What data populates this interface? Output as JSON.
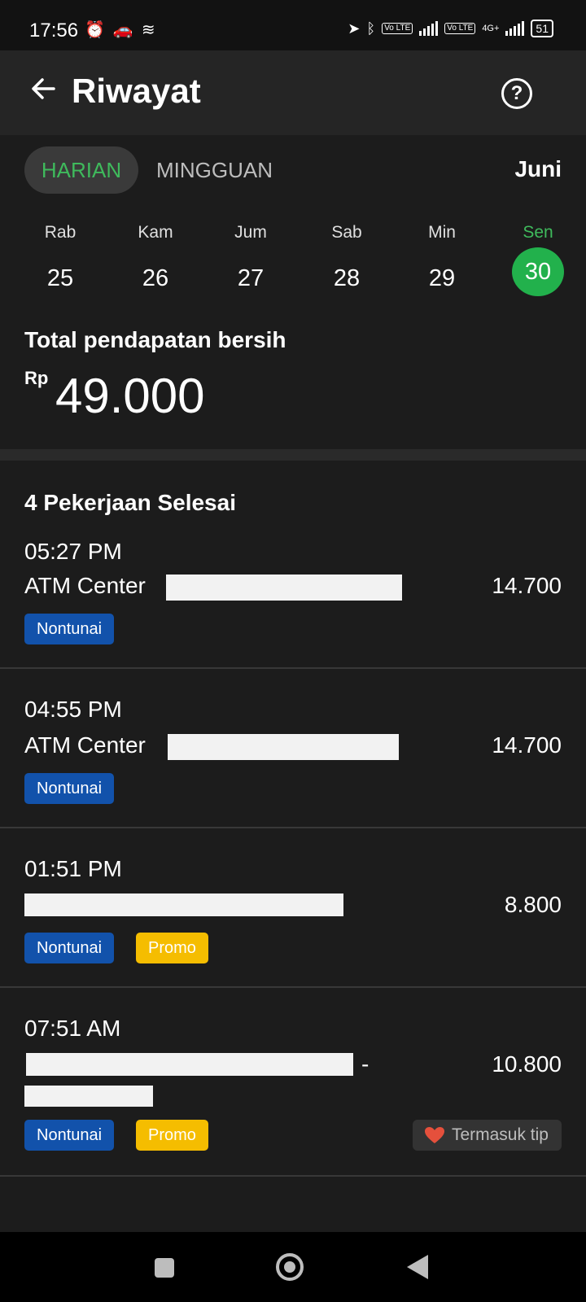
{
  "status_bar": {
    "time": "17:56",
    "sim1": "Vo LTE",
    "sim2": "Vo LTE",
    "network": "4G+",
    "battery": "51"
  },
  "app_bar": {
    "title": "Riwayat",
    "help": "?"
  },
  "tabs": {
    "daily": "HARIAN",
    "weekly": "MINGGUAN",
    "month": "Juni"
  },
  "days": [
    {
      "name": "Rab",
      "date": "25"
    },
    {
      "name": "Kam",
      "date": "26"
    },
    {
      "name": "Jum",
      "date": "27"
    },
    {
      "name": "Sab",
      "date": "28"
    },
    {
      "name": "Min",
      "date": "29"
    },
    {
      "name": "Sen",
      "date": "30",
      "selected": true
    }
  ],
  "summary": {
    "label": "Total pendapatan bersih",
    "currency": "Rp",
    "value": "49.000"
  },
  "jobs_title": "4 Pekerjaan Selesai",
  "jobs": [
    {
      "time": "05:27 PM",
      "place": "ATM Center",
      "amount": "14.700",
      "badges": [
        "Nontunai"
      ]
    },
    {
      "time": "04:55 PM",
      "place": "ATM Center",
      "amount": "14.700",
      "badges": [
        "Nontunai"
      ]
    },
    {
      "time": "01:51 PM",
      "place": "",
      "amount": "8.800",
      "badges": [
        "Nontunai",
        "Promo"
      ]
    },
    {
      "time": "07:51 AM",
      "place": "-",
      "amount": "10.800",
      "badges": [
        "Nontunai",
        "Promo"
      ],
      "tip": "Termasuk tip"
    }
  ],
  "colors": {
    "accent_green": "#22b14c",
    "nontunai_blue": "#1252ab",
    "promo_yellow": "#f5bd00",
    "tip_heart": "#e5503c"
  }
}
